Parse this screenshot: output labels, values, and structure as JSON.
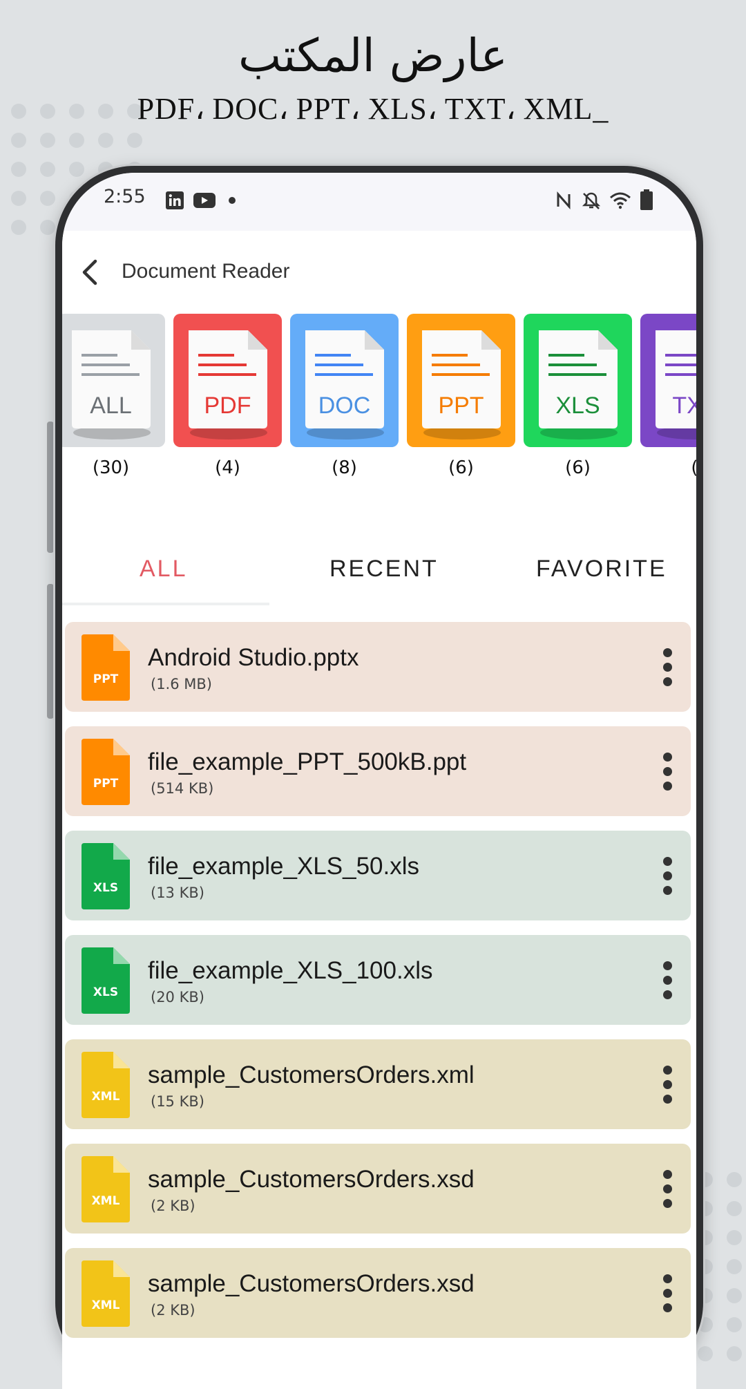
{
  "promo": {
    "title": "عارض المكتب",
    "subtitle": "PDF، DOC، PPT، XLS، TXT، XML_"
  },
  "status_bar": {
    "time": "2:55",
    "left_icons": [
      "linkedin-icon",
      "youtube-icon",
      "dot-icon"
    ],
    "right_icons": [
      "nfc-icon",
      "bell-off-icon",
      "wifi-icon",
      "battery-icon"
    ]
  },
  "app_bar": {
    "back_icon": "chevron-left-icon",
    "title": "Document Reader"
  },
  "categories": [
    {
      "label": "ALL",
      "count": "(30)",
      "bg": "#d9dcdf",
      "accent": "#9aa0a6",
      "text": "#6b7075"
    },
    {
      "label": "PDF",
      "count": "(4)",
      "bg": "#f15050",
      "accent": "#e53935",
      "text": "#e53935"
    },
    {
      "label": "DOC",
      "count": "(8)",
      "bg": "#64acf8",
      "accent": "#4285f4",
      "text": "#4a90e2"
    },
    {
      "label": "PPT",
      "count": "(6)",
      "bg": "#ff9e12",
      "accent": "#f57c00",
      "text": "#f57c00"
    },
    {
      "label": "XLS",
      "count": "(6)",
      "bg": "#1fd65c",
      "accent": "#1b8f3a",
      "text": "#1b8f3a"
    },
    {
      "label": "TXT",
      "count": "(",
      "bg": "#7b47c6",
      "accent": "#7b47c6",
      "text": "#7b47c6"
    }
  ],
  "tabs": [
    {
      "label": "ALL",
      "active": true
    },
    {
      "label": "RECENT",
      "active": false
    },
    {
      "label": "FAVORITE",
      "active": false
    }
  ],
  "files": [
    {
      "name": "Android Studio.pptx",
      "size": "(1.6 MB)",
      "type": "PPT"
    },
    {
      "name": "file_example_PPT_500kB.ppt",
      "size": "(514 KB)",
      "type": "PPT"
    },
    {
      "name": "file_example_XLS_50.xls",
      "size": "(13 KB)",
      "type": "XLS"
    },
    {
      "name": "file_example_XLS_100.xls",
      "size": "(20 KB)",
      "type": "XLS"
    },
    {
      "name": "sample_CustomersOrders.xml",
      "size": "(15 KB)",
      "type": "XML"
    },
    {
      "name": "sample_CustomersOrders.xsd",
      "size": "(2 KB)",
      "type": "XML"
    },
    {
      "name": "sample_CustomersOrders.xsd",
      "size": "(2 KB)",
      "type": "XML"
    }
  ],
  "colors": {
    "active_tab": "#e25a63",
    "ppt_row": "#f1e2d9",
    "xls_row": "#d8e3dc",
    "xml_row": "#e7e0c3",
    "ppt_icon": "#ff8a00",
    "xls_icon": "#12a94a",
    "xml_icon": "#f2c418"
  }
}
